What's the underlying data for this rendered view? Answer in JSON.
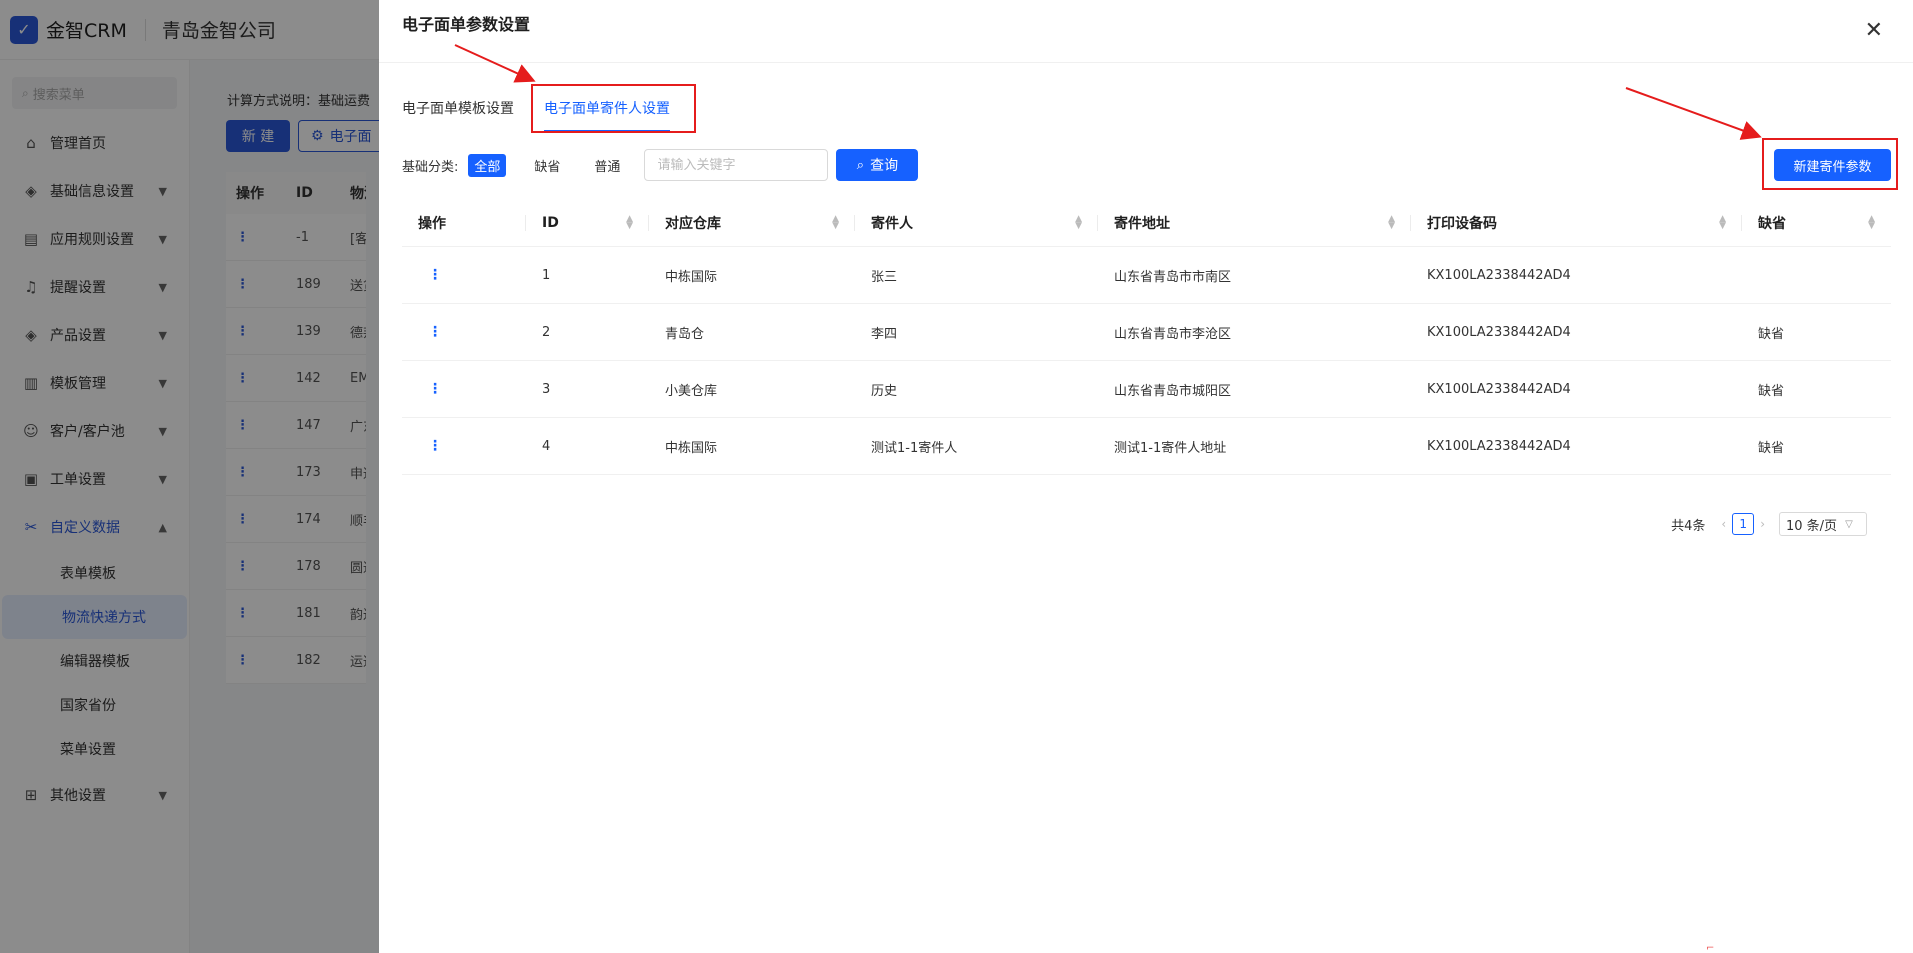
{
  "app": {
    "logo_label": "金智CRM",
    "company": "青岛金智公司"
  },
  "sidebar": {
    "search_placeholder": "搜索菜单",
    "items": [
      {
        "label": "管理首页",
        "icon": "home-icon"
      },
      {
        "label": "基础信息设置",
        "icon": "cube-icon"
      },
      {
        "label": "应用规则设置",
        "icon": "document-icon"
      },
      {
        "label": "提醒设置",
        "icon": "bell-icon"
      },
      {
        "label": "产品设置",
        "icon": "cube-icon"
      },
      {
        "label": "模板管理",
        "icon": "template-icon"
      },
      {
        "label": "客户/客户池",
        "icon": "user-icon"
      },
      {
        "label": "工单设置",
        "icon": "ticket-icon"
      },
      {
        "label": "自定义数据",
        "icon": "tools-icon"
      }
    ],
    "sub_items": [
      "表单模板",
      "物流快递方式",
      "编辑器模板",
      "国家省份",
      "菜单设置"
    ],
    "bottom_item": {
      "label": "其他设置",
      "icon": "grid-icon"
    }
  },
  "background": {
    "calc_note": "计算方式说明：基础运费",
    "new_button": "新 建",
    "ewb_button": "电子面",
    "columns": [
      "操作",
      "ID",
      "物流"
    ],
    "rows": [
      {
        "id": "-1",
        "name": "[客户"
      },
      {
        "id": "189",
        "name": "送货"
      },
      {
        "id": "139",
        "name": "德邦"
      },
      {
        "id": "142",
        "name": "EMS"
      },
      {
        "id": "147",
        "name": "广东"
      },
      {
        "id": "173",
        "name": "申通"
      },
      {
        "id": "174",
        "name": "顺丰"
      },
      {
        "id": "178",
        "name": "圆通"
      },
      {
        "id": "181",
        "name": "韵达"
      },
      {
        "id": "182",
        "name": "运通"
      }
    ]
  },
  "drawer": {
    "title": "电子面单参数设置",
    "tabs": [
      "电子面单模板设置",
      "电子面单寄件人设置"
    ],
    "filter_label": "基础分类:",
    "chips": [
      "全部",
      "缺省",
      "普通"
    ],
    "search_placeholder": "请输入关键字",
    "query_button": "查询",
    "new_button": "新建寄件参数",
    "columns": [
      "操作",
      "ID",
      "对应仓库",
      "寄件人",
      "寄件地址",
      "打印设备码",
      "缺省"
    ],
    "rows": [
      {
        "id": "1",
        "warehouse": "中栋国际",
        "sender": "张三",
        "address": "山东省青岛市市南区",
        "device": "KX100LA2338442AD4",
        "default": ""
      },
      {
        "id": "2",
        "warehouse": "青岛仓",
        "sender": "李四",
        "address": "山东省青岛市李沧区",
        "device": "KX100LA2338442AD4",
        "default": "缺省"
      },
      {
        "id": "3",
        "warehouse": "小美仓库",
        "sender": "历史",
        "address": "山东省青岛市城阳区",
        "device": "KX100LA2338442AD4",
        "default": "缺省"
      },
      {
        "id": "4",
        "warehouse": "中栋国际",
        "sender": "测试1-1寄件人",
        "address": "测试1-1寄件人地址",
        "device": "KX100LA2338442AD4",
        "default": "缺省"
      }
    ],
    "pager": {
      "total": "共4条",
      "page": "1",
      "size": "10 条/页"
    }
  },
  "colors": {
    "primary": "#1661ff",
    "annotation": "#e51c1c",
    "brand": "#2b58d9"
  }
}
